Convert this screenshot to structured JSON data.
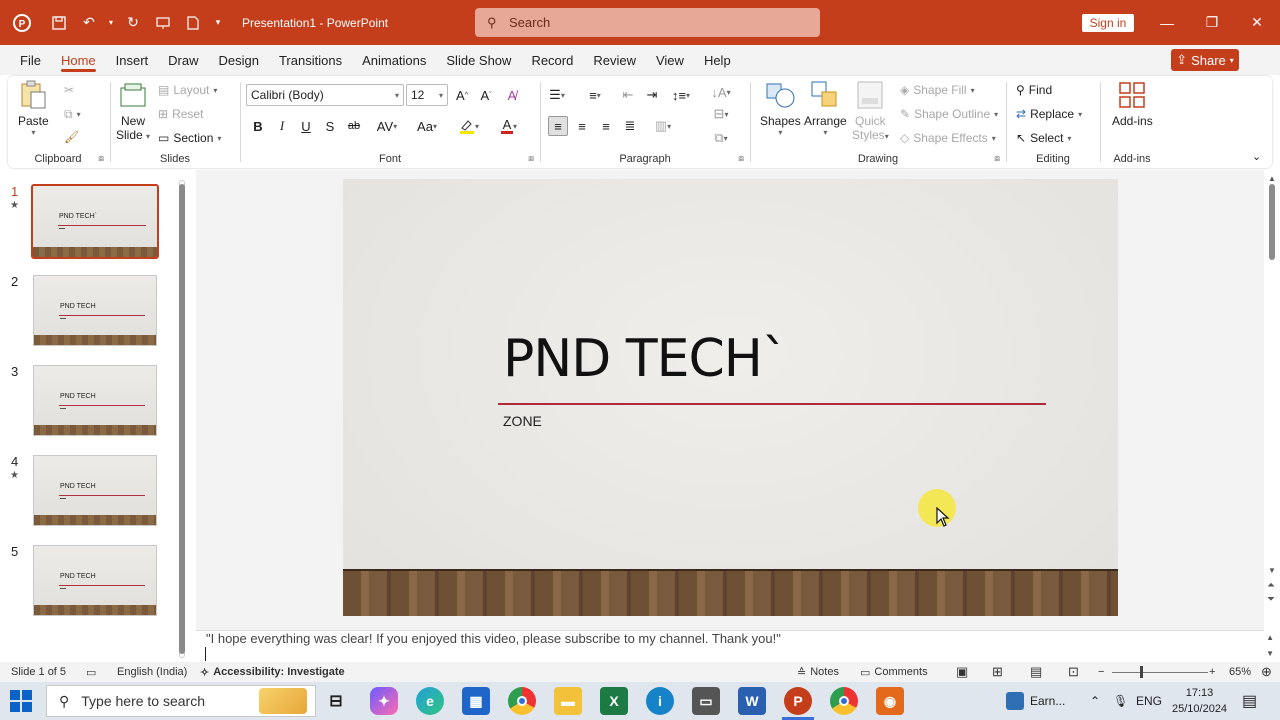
{
  "titlebar": {
    "title": "Presentation1  -  PowerPoint",
    "search_placeholder": "Search",
    "sign_in": "Sign in"
  },
  "menu": {
    "tabs": [
      "File",
      "Home",
      "Insert",
      "Draw",
      "Design",
      "Transitions",
      "Animations",
      "Slide Show",
      "Record",
      "Review",
      "View",
      "Help"
    ],
    "active": "Home",
    "share": "Share"
  },
  "ribbon": {
    "clipboard": {
      "label": "Clipboard",
      "paste": "Paste"
    },
    "slides": {
      "label": "Slides",
      "new_slide_1": "New",
      "new_slide_2": "Slide",
      "layout": "Layout",
      "reset": "Reset",
      "section": "Section"
    },
    "font": {
      "label": "Font",
      "font_name": "Calibri (Body)",
      "font_size": "12"
    },
    "paragraph": {
      "label": "Paragraph"
    },
    "drawing": {
      "label": "Drawing",
      "shapes": "Shapes",
      "arrange": "Arrange",
      "quick_styles_1": "Quick",
      "quick_styles_2": "Styles",
      "shape_fill": "Shape Fill",
      "shape_outline": "Shape Outline",
      "shape_effects": "Shape Effects"
    },
    "editing": {
      "label": "Editing",
      "find": "Find",
      "replace": "Replace",
      "select": "Select"
    },
    "addins": {
      "label": "Add-ins",
      "button": "Add-ins"
    }
  },
  "thumbnails": [
    {
      "num": "1",
      "title": "PND TECH`",
      "star": true,
      "selected": true
    },
    {
      "num": "2",
      "title": "PND TECH",
      "star": false,
      "selected": false
    },
    {
      "num": "3",
      "title": "PND TECH",
      "star": false,
      "selected": false
    },
    {
      "num": "4",
      "title": "PND TECH",
      "star": true,
      "selected": false
    },
    {
      "num": "5",
      "title": "PND TECH",
      "star": false,
      "selected": false
    }
  ],
  "slide": {
    "title": "PND TECH`",
    "subtitle": "ZONE"
  },
  "notes": {
    "text": "\"I hope everything was clear! If you enjoyed this video, please subscribe to my channel. Thank you!\""
  },
  "status": {
    "slide_count": "Slide 1 of 5",
    "language": "English (India)",
    "accessibility": "Accessibility: Investigate",
    "notes": "Notes",
    "comments": "Comments",
    "zoom": "65%"
  },
  "taskbar": {
    "search_placeholder": "Type here to search",
    "weather": "Earn...",
    "lang": "ENG",
    "time": "17:13",
    "date": "25/10/2024"
  },
  "colors": {
    "accent": "#c43e1c",
    "slide_line": "#b02a3a"
  }
}
